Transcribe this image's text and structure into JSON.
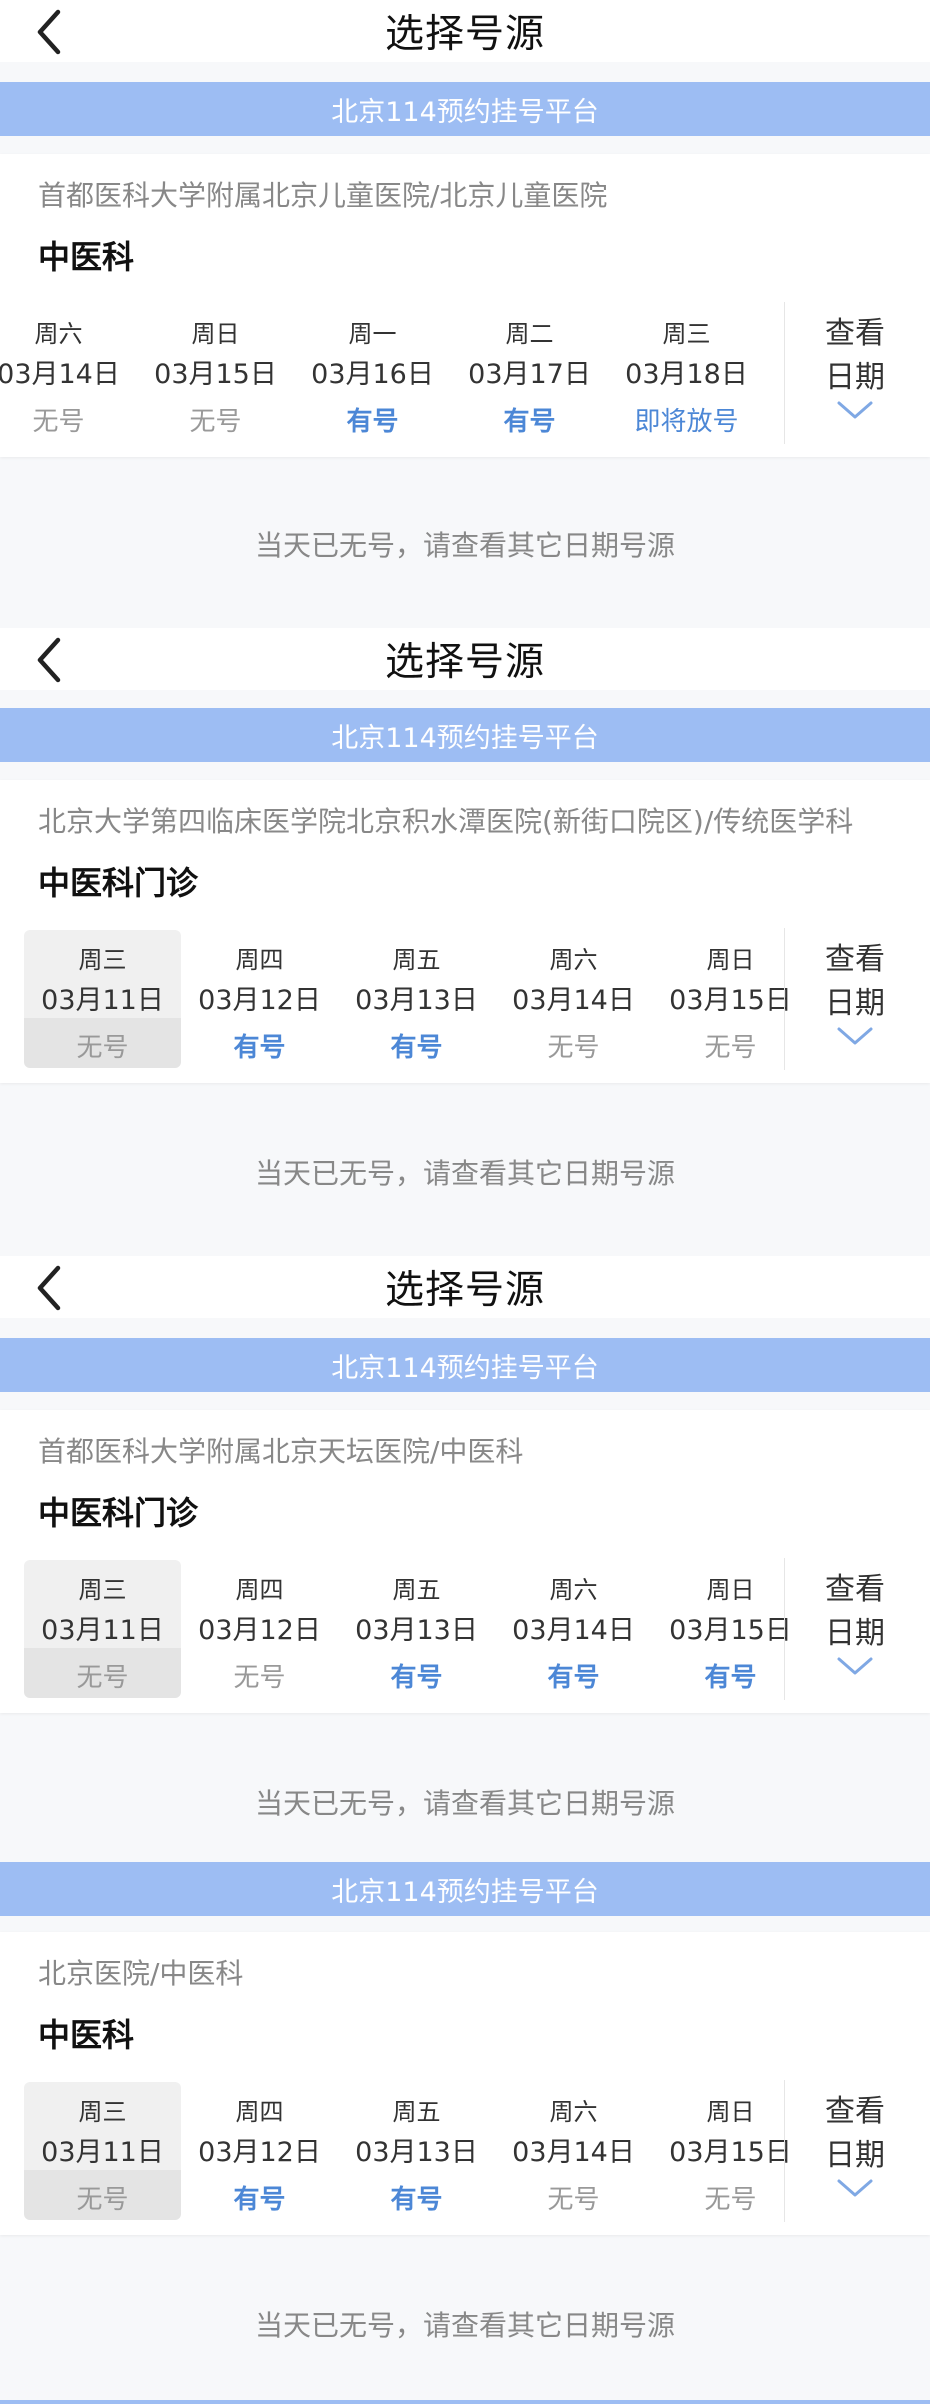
{
  "panels": [
    {
      "header_title": "选择号源",
      "banner": "北京114预约挂号平台",
      "hospital": "首都医科大学附属北京儿童医院/北京儿童医院",
      "department": "中医科",
      "days": [
        {
          "weekday": "周六",
          "date": "03月14日",
          "status": "无号"
        },
        {
          "weekday": "周日",
          "date": "03月15日",
          "status": "无号"
        },
        {
          "weekday": "周一",
          "date": "03月16日",
          "status": "有号"
        },
        {
          "weekday": "周二",
          "date": "03月17日",
          "status": "有号"
        },
        {
          "weekday": "周三",
          "date": "03月18日",
          "status": "即将放号"
        }
      ],
      "more_line1": "查看",
      "more_line2": "日期",
      "notice": "当天已无号，请查看其它日期号源"
    },
    {
      "header_title": "选择号源",
      "banner": "北京114预约挂号平台",
      "hospital": "北京大学第四临床医学院北京积水潭医院(新街口院区)/传统医学科",
      "department": "中医科门诊",
      "days": [
        {
          "weekday": "周三",
          "date": "03月11日",
          "status": "无号"
        },
        {
          "weekday": "周四",
          "date": "03月12日",
          "status": "有号"
        },
        {
          "weekday": "周五",
          "date": "03月13日",
          "status": "有号"
        },
        {
          "weekday": "周六",
          "date": "03月14日",
          "status": "无号"
        },
        {
          "weekday": "周日",
          "date": "03月15日",
          "status": "无号"
        }
      ],
      "more_line1": "查看",
      "more_line2": "日期",
      "notice": "当天已无号，请查看其它日期号源"
    },
    {
      "header_title": "选择号源",
      "banner": "北京114预约挂号平台",
      "hospital": "首都医科大学附属北京天坛医院/中医科",
      "department": "中医科门诊",
      "days": [
        {
          "weekday": "周三",
          "date": "03月11日",
          "status": "无号"
        },
        {
          "weekday": "周四",
          "date": "03月12日",
          "status": "无号"
        },
        {
          "weekday": "周五",
          "date": "03月13日",
          "status": "有号"
        },
        {
          "weekday": "周六",
          "date": "03月14日",
          "status": "有号"
        },
        {
          "weekday": "周日",
          "date": "03月15日",
          "status": "有号"
        }
      ],
      "more_line1": "查看",
      "more_line2": "日期",
      "notice": "当天已无号，请查看其它日期号源"
    },
    {
      "header_title": "",
      "banner": "北京114预约挂号平台",
      "hospital": "北京医院/中医科",
      "department": "中医科",
      "days": [
        {
          "weekday": "周三",
          "date": "03月11日",
          "status": "无号"
        },
        {
          "weekday": "周四",
          "date": "03月12日",
          "status": "有号"
        },
        {
          "weekday": "周五",
          "date": "03月13日",
          "status": "有号"
        },
        {
          "weekday": "周六",
          "date": "03月14日",
          "status": "无号"
        },
        {
          "weekday": "周日",
          "date": "03月15日",
          "status": "无号"
        }
      ],
      "more_line1": "查看",
      "more_line2": "日期",
      "notice": "当天已无号，请查看其它日期号源"
    }
  ],
  "colors": {
    "banner": "#9dbdf3",
    "available": "#4c87d6",
    "unavailable": "#999999"
  }
}
